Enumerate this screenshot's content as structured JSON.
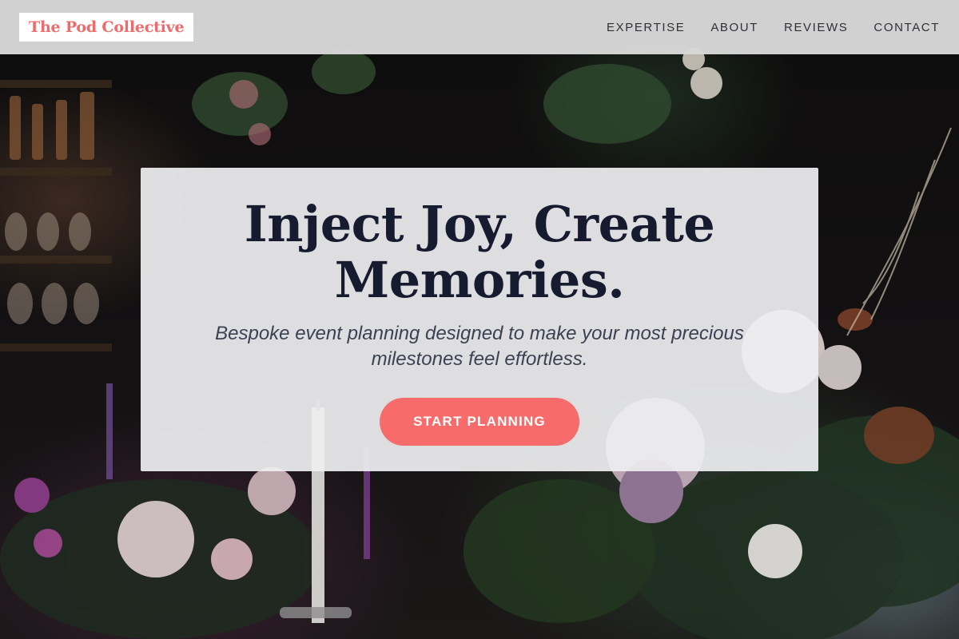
{
  "brand": {
    "name": "The Pod Collective",
    "color": "#ef6b6b"
  },
  "nav": {
    "links": [
      {
        "label": "EXPERTISE"
      },
      {
        "label": "ABOUT"
      },
      {
        "label": "REVIEWS"
      },
      {
        "label": "CONTACT"
      }
    ]
  },
  "hero": {
    "title": "Inject Joy, Create Memories.",
    "subtitle": "Bespoke event planning designed to make your most precious milestones feel effortless.",
    "cta_label": "START PLANNING",
    "cta_color": "#f76b6b",
    "title_color": "#161b2f",
    "background_description_icon": "floral-event-photo"
  }
}
